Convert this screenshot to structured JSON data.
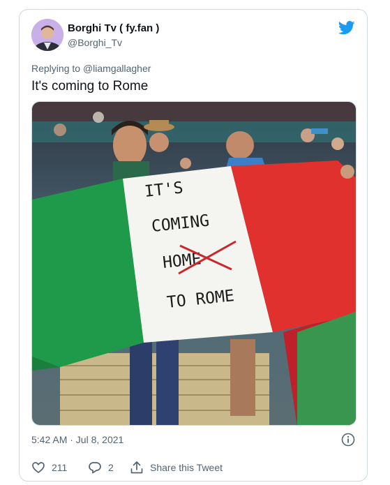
{
  "tweet": {
    "display_name": "Borghi Tv ( fy.fan )",
    "handle": "@Borghi_Tv",
    "replying_label": "Replying to",
    "replying_to": "@liamgallagher",
    "text": "It's coming to Rome",
    "timestamp": "5:42 AM · Jul 8, 2021"
  },
  "photo": {
    "flag_lines": [
      "IT'S",
      "COMING",
      "HOME",
      "TO ROME"
    ]
  },
  "actions": {
    "like_count": "211",
    "reply_count": "2",
    "share_label": "Share this Tweet"
  },
  "colors": {
    "twitter_blue": "#1d9bf0",
    "flag_green": "#1f9a4a",
    "flag_white": "#f4f4f1",
    "flag_red": "#e0312f",
    "secondary_text": "#536471"
  },
  "icons": {
    "logo": "twitter-bird-icon",
    "info": "info-icon",
    "like": "heart-icon",
    "reply": "reply-bubble-icon",
    "share": "share-icon"
  }
}
